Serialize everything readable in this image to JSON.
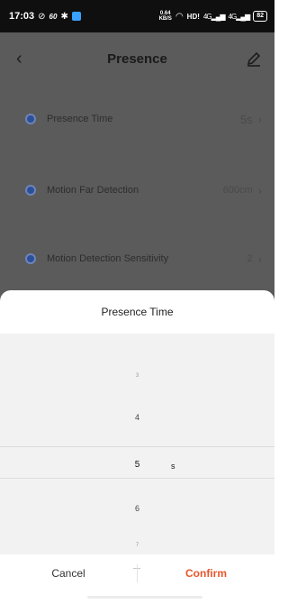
{
  "status_bar": {
    "time": "17:03",
    "left_small": "60",
    "speed_top": "0.64",
    "speed_bottom": "KB/S",
    "hd_label": "HD!",
    "signal1": "4G",
    "signal2": "4G",
    "battery": "82"
  },
  "nav": {
    "title": "Presence"
  },
  "settings": [
    {
      "label": "Presence Time",
      "value": "5s"
    },
    {
      "label": "Motion Far Detection",
      "value": "600cm"
    },
    {
      "label": "Motion Detection Sensitivity",
      "value": "2"
    }
  ],
  "sheet": {
    "title": "Presence Time",
    "picker": {
      "items": [
        "3",
        "4",
        "5",
        "6",
        "7"
      ],
      "selected": "5",
      "unit": "s"
    },
    "cancel_label": "Cancel",
    "confirm_label": "Confirm"
  },
  "colors": {
    "accent": "#e8562a",
    "overlay": "#5b5b5b",
    "radio": "#2c4f9a"
  }
}
